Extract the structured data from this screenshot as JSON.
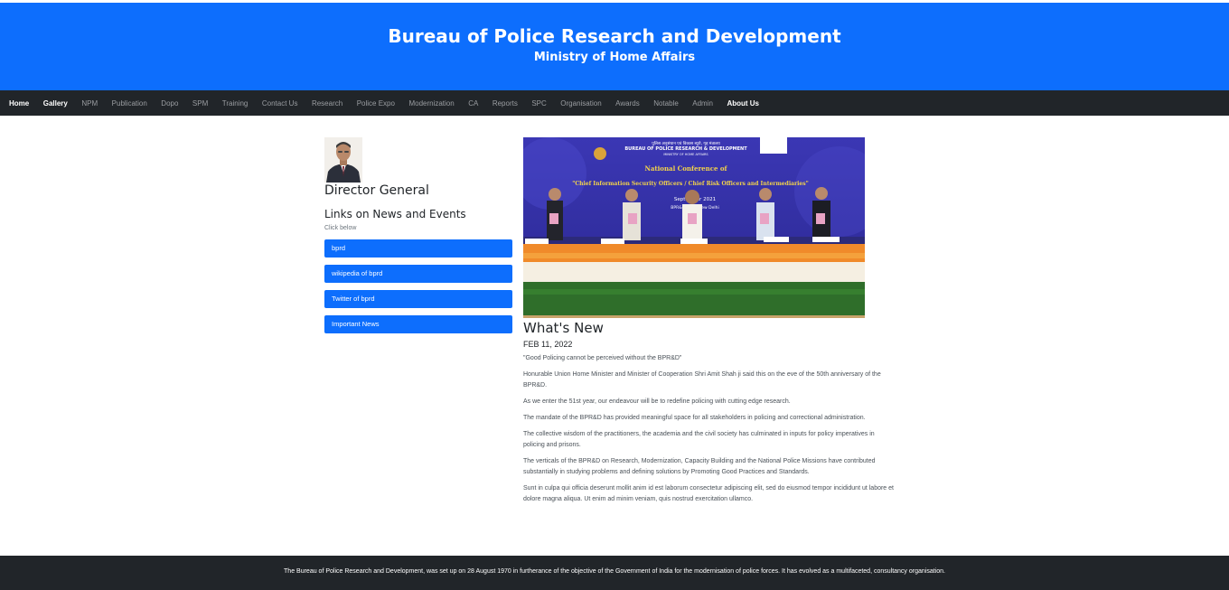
{
  "header": {
    "title": "Bureau of Police Research and Development",
    "subtitle": "Ministry of Home Affairs",
    "background_color": "#0d6efd"
  },
  "nav": {
    "items": [
      {
        "label": "Home",
        "active": true
      },
      {
        "label": "Gallery",
        "active": true
      },
      {
        "label": "NPM",
        "active": false
      },
      {
        "label": "Publication",
        "active": false
      },
      {
        "label": "Dopo",
        "active": false
      },
      {
        "label": "SPM",
        "active": false
      },
      {
        "label": "Training",
        "active": false
      },
      {
        "label": "Contact Us",
        "active": false
      },
      {
        "label": "Research",
        "active": false
      },
      {
        "label": "Police Expo",
        "active": false
      },
      {
        "label": "Modernization",
        "active": false
      },
      {
        "label": "CA",
        "active": false
      },
      {
        "label": "Reports",
        "active": false
      },
      {
        "label": "SPC",
        "active": false
      },
      {
        "label": "Organisation",
        "active": false
      },
      {
        "label": "Awards",
        "active": false
      },
      {
        "label": "Notable",
        "active": false
      },
      {
        "label": "Admin",
        "active": false
      },
      {
        "label": "About Us",
        "active": true
      }
    ]
  },
  "sidebar": {
    "dg_title": "Director General",
    "links_title": "Links on News and Events",
    "click_below": "Click below",
    "buttons": [
      {
        "label": "bprd"
      },
      {
        "label": "wikipedia of bprd"
      },
      {
        "label": "Twitter of bprd"
      },
      {
        "label": "Important News"
      }
    ]
  },
  "banner": {
    "org_hindi": "पुलिस अनुसंधान एवं विकास ब्यूरो, गृह मंत्रालय",
    "org_line": "BUREAU OF POLICE RESEARCH & DEVELOPMENT",
    "ministry": "MINISTRY OF HOME AFFAIRS",
    "event_line1": "National Conference of",
    "event_line2": "\"Chief Information Security Officers / Chief Risk Officers and Intermediaries\"",
    "event_date": "September 2021",
    "event_place": "BPR&D Hqrs, New Delhi"
  },
  "news": {
    "heading": "What's New",
    "date": "FEB 11, 2022",
    "paragraphs": [
      "\"Good Policing cannot be perceived without the BPR&D\"",
      "Honurable Union Home Minister and Minister of Cooperation Shri Amit Shah ji said this on the eve of the 50th anniversary of the BPR&D.",
      "As we enter the 51st year, our endeavour will be to redefine policing with cutting edge research.",
      "The mandate of the BPR&D has provided meaningful space for all stakeholders in policing and correctional administration.",
      "The collective wisdom of the practitioners, the academia and the civil society has culminated in inputs for policy imperatives in policing and prisons.",
      "The verticals of the BPR&D on Research, Modernization, Capacity Building and the National Police Missions have contributed substantially in studying problems and defining solutions by Promoting Good Practices and Standards.",
      "Sunt in culpa qui officia deserunt mollit anim id est laborum consectetur adipiscing elit, sed do eiusmod tempor incididunt ut labore et dolore magna aliqua. Ut enim ad minim veniam, quis nostrud exercitation ullamco."
    ]
  },
  "footer": {
    "text": "The Bureau of Police Research and Development, was set up on 28 August 1970 in furtherance of the objective of the Government of India for the modernisation of police forces. It has evolved as a multifaceted, consultancy organisation."
  }
}
